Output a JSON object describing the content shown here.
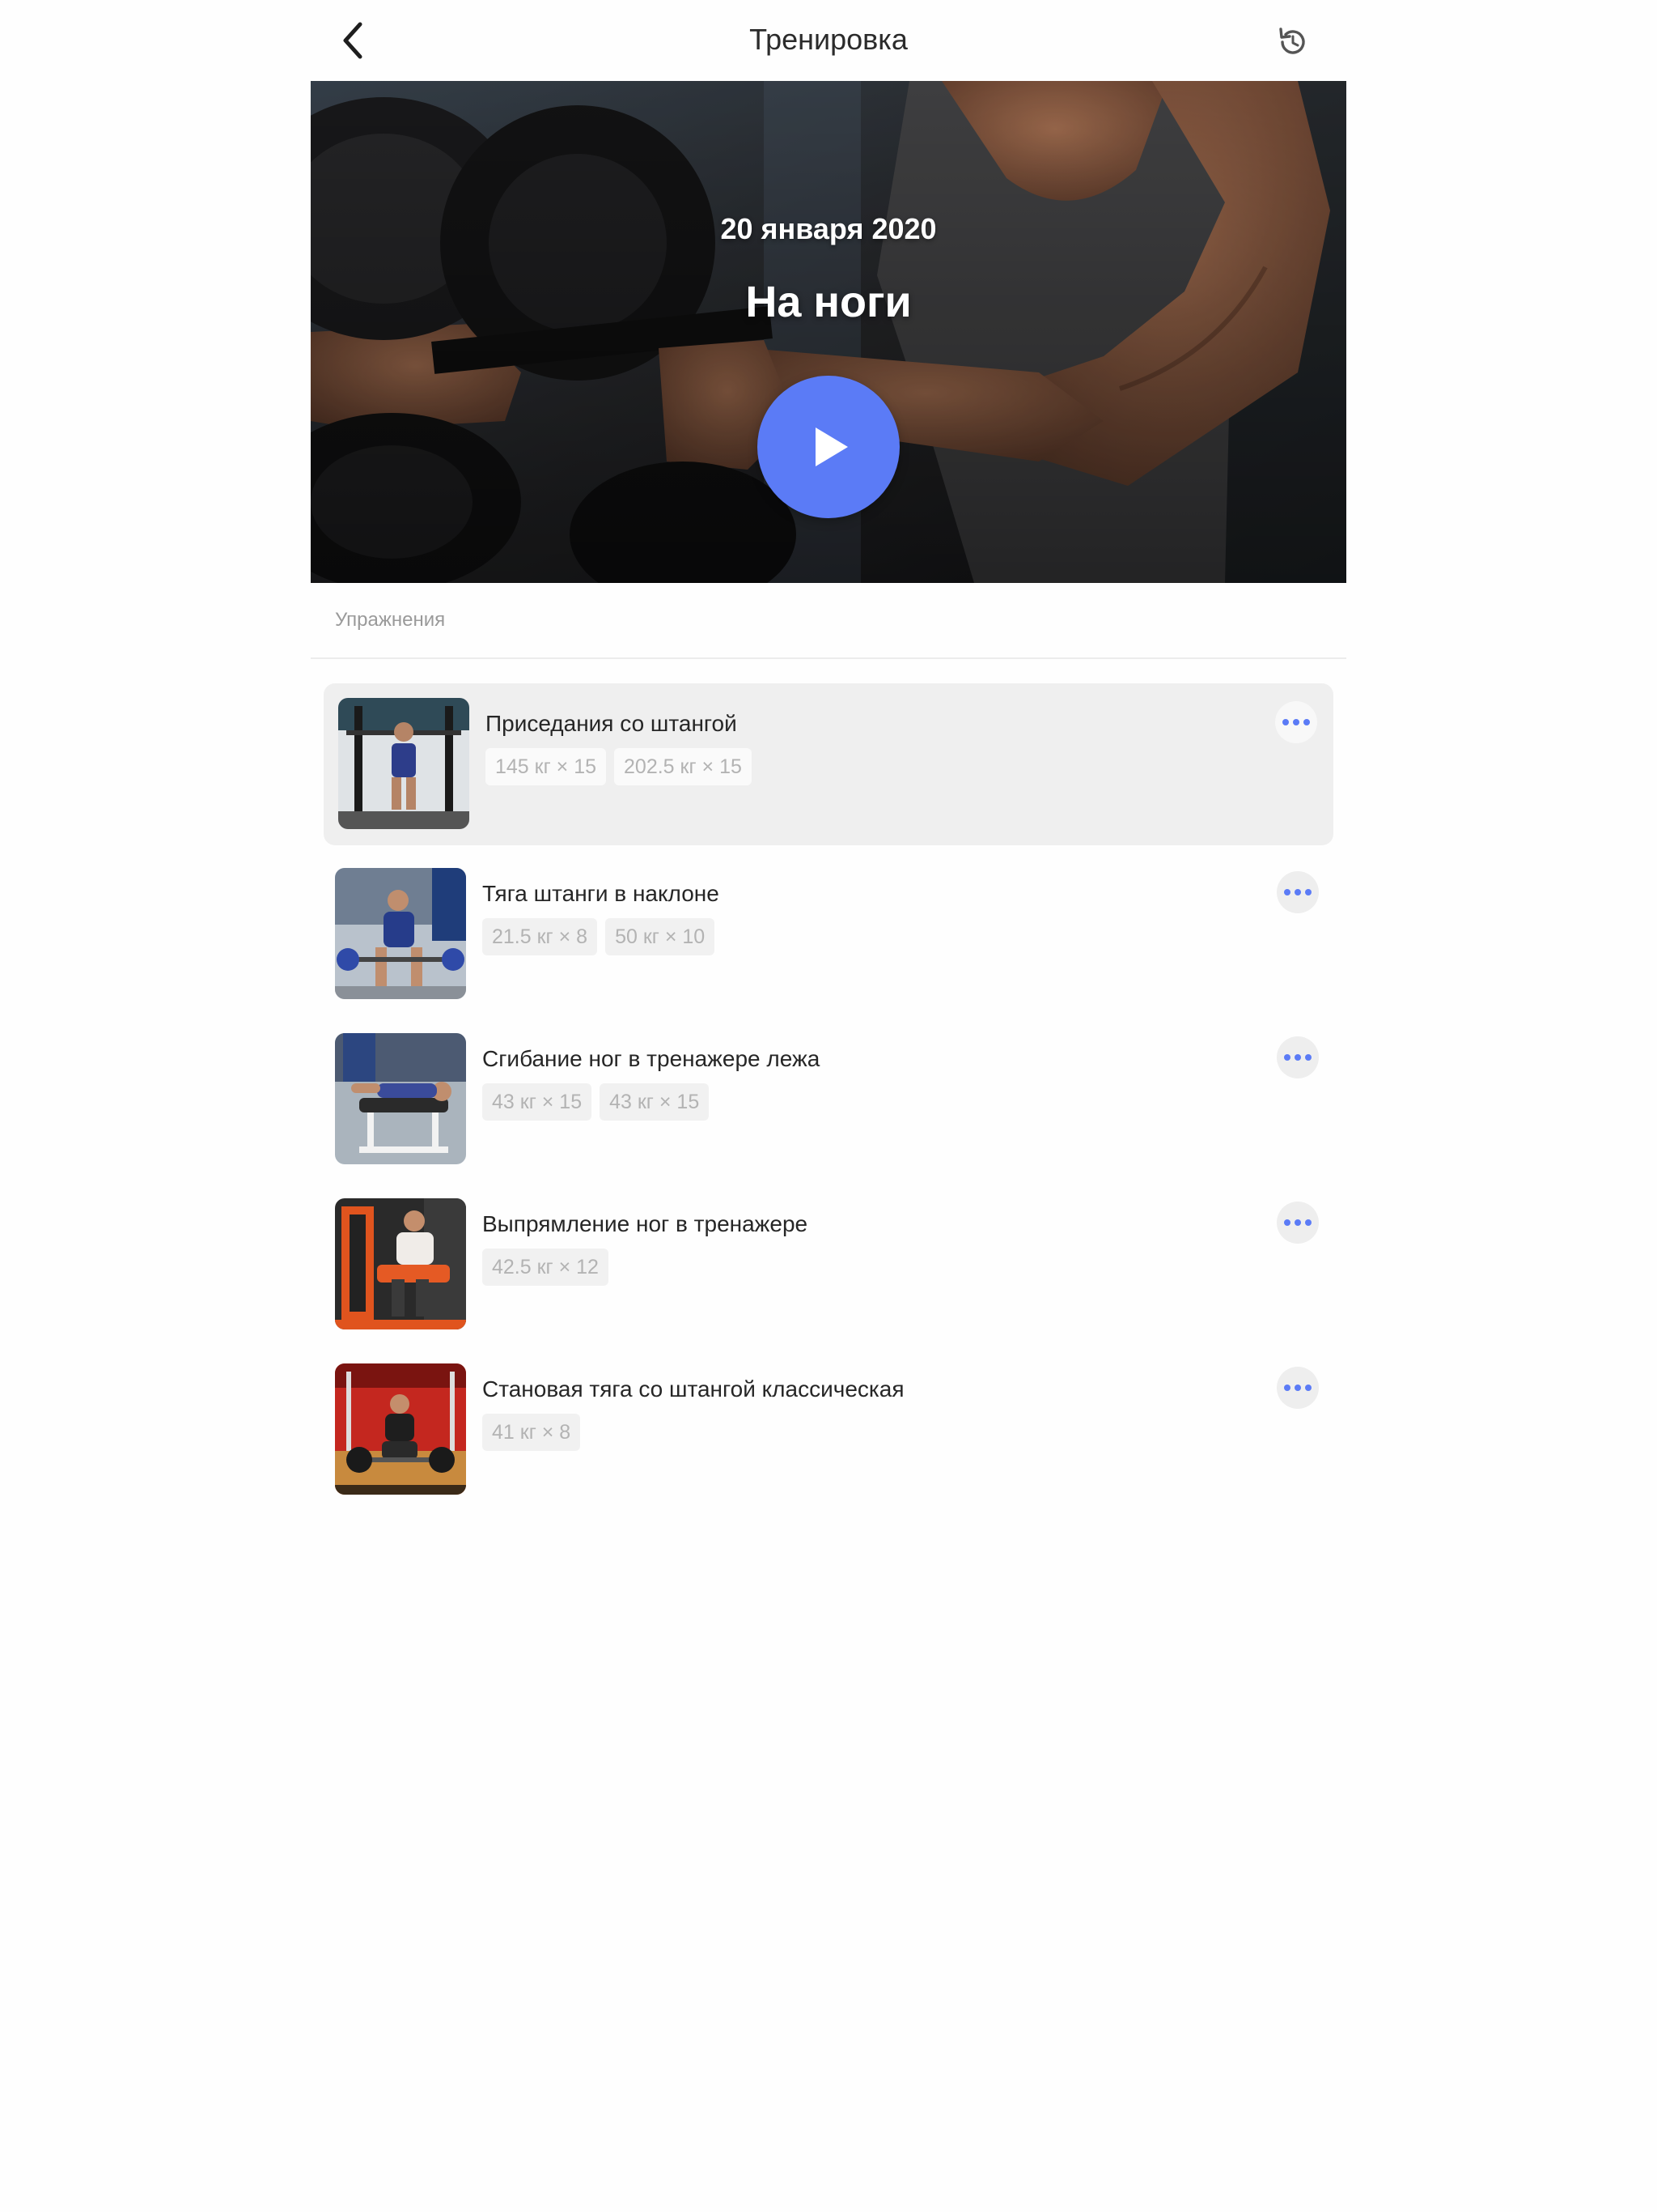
{
  "header": {
    "title": "Тренировка",
    "back_icon": "chevron-left-icon",
    "refresh_icon": "refresh-icon"
  },
  "hero": {
    "date": "20 января 2020",
    "workout_name": "На ноги",
    "play_icon": "play-icon",
    "play_color": "#5b7bf6"
  },
  "section": {
    "label": "Упражнения"
  },
  "exercises": [
    {
      "name": "Приседания со штангой",
      "sets": [
        "145 кг × 15",
        "202.5 кг × 15"
      ]
    },
    {
      "name": "Тяга штанги в наклоне",
      "sets": [
        "21.5 кг × 8",
        "50 кг × 10"
      ]
    },
    {
      "name": "Сгибание ног в тренажере лежа",
      "sets": [
        "43 кг × 15",
        "43 кг × 15"
      ]
    },
    {
      "name": "Выпрямление ног в тренажере",
      "sets": [
        "42.5 кг × 12"
      ]
    },
    {
      "name": "Становая тяга со штангой классическая",
      "sets": [
        "41 кг × 8"
      ]
    }
  ],
  "colors": {
    "accent": "#5b7bf6",
    "text_primary": "#262626",
    "text_muted": "#9a9a9a",
    "chip_text": "#b3b3b3",
    "active_row_bg": "#efefef"
  }
}
